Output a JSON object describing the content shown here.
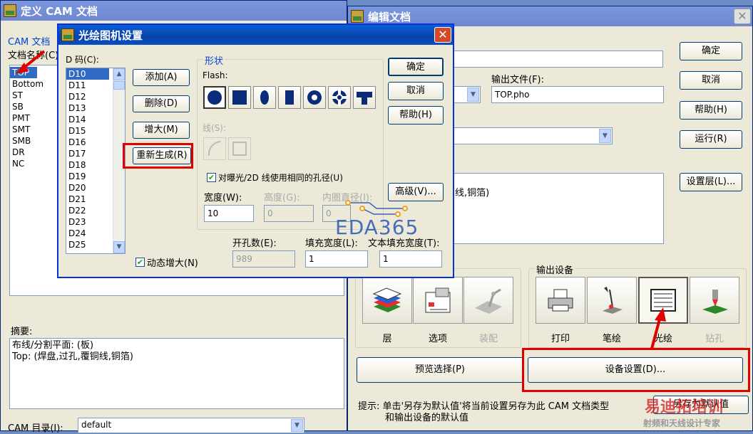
{
  "cam_window": {
    "title": "定义 CAM 文档",
    "group_label": "CAM 文档",
    "doc_name_label": "文档名称(C)",
    "doc_list": [
      "TOP",
      "Bottom",
      "ST",
      "SB",
      "PMT",
      "SMT",
      "SMB",
      "DR",
      "NC"
    ],
    "selected_doc": "TOP",
    "summary_label": "摘要:",
    "summary_line1": "布线/分割平面: (板)",
    "summary_line2": "Top: (焊盘,过孔,覆铜线,铜箔)",
    "cam_dir_label": "CAM 目录(I):",
    "cam_dir_value": "default"
  },
  "edit_window": {
    "title": "编辑文档",
    "ok": "确定",
    "cancel": "取消",
    "help": "帮助(H)",
    "run": "运行(R)",
    "layers": "设置层(L)...",
    "output_file_label": "输出文件(F):",
    "output_file_value": "TOP.pho",
    "layer_summary": "线,铜箔)",
    "output_device_group": "输出设备",
    "cust_items": [
      {
        "label": "层",
        "icon": "layers-icon"
      },
      {
        "label": "选项",
        "icon": "options-icon"
      },
      {
        "label": "装配",
        "icon": "assembly-icon",
        "disabled": true
      }
    ],
    "devices": [
      {
        "label": "打印",
        "icon": "printer-icon"
      },
      {
        "label": "笔绘",
        "icon": "pen-plotter-icon"
      },
      {
        "label": "光绘",
        "icon": "photo-plotter-icon",
        "selected": true
      },
      {
        "label": "钻孔",
        "icon": "drill-icon",
        "disabled": true
      }
    ],
    "preview": "预览选择(P)",
    "device_setup": "设备设置(D)...",
    "hint_line1": "提示: 单击'另存为默认值'将当前设置另存为此 CAM 文档类型",
    "hint_line2": "和输出设备的默认值",
    "save_default": "另存为默认值"
  },
  "plotter_dialog": {
    "title": "光绘图机设置",
    "dcode_label": "D 码(C):",
    "dcodes": [
      "D10",
      "D11",
      "D12",
      "D13",
      "D14",
      "D15",
      "D16",
      "D17",
      "D18",
      "D19",
      "D20",
      "D21",
      "D22",
      "D23",
      "D24",
      "D25"
    ],
    "selected_dcode": "D10",
    "add": "添加(A)",
    "delete": "删除(D)",
    "augment": "增大(M)",
    "regenerate": "重新生成(R)",
    "shape_group": "形状",
    "flash_label": "Flash:",
    "line_label": "线(S):",
    "same_drill_label": "对曝光/2D 线使用相同的孔径(U)",
    "same_drill_checked": true,
    "width_label": "宽度(W):",
    "width_value": "10",
    "height_label": "高度(G):",
    "height_value": "0",
    "inner_label": "内圈直径(I):",
    "inner_value": "0",
    "ok": "确定",
    "cancel": "取消",
    "help": "帮助(H)",
    "advanced": "高级(V)...",
    "auto_augment_label": "动态增大(N)",
    "auto_augment_checked": true,
    "hole_count_label": "开孔数(E):",
    "hole_count_value": "989",
    "fill_width_label": "填充宽度(L):",
    "fill_width_value": "1",
    "text_fill_width_label": "文本填充宽度(T):",
    "text_fill_width_value": "1"
  },
  "watermark": {
    "eda": "EDA365",
    "site_line1": "易迪拓培训",
    "site_line2": "射频和天线设计专家"
  }
}
